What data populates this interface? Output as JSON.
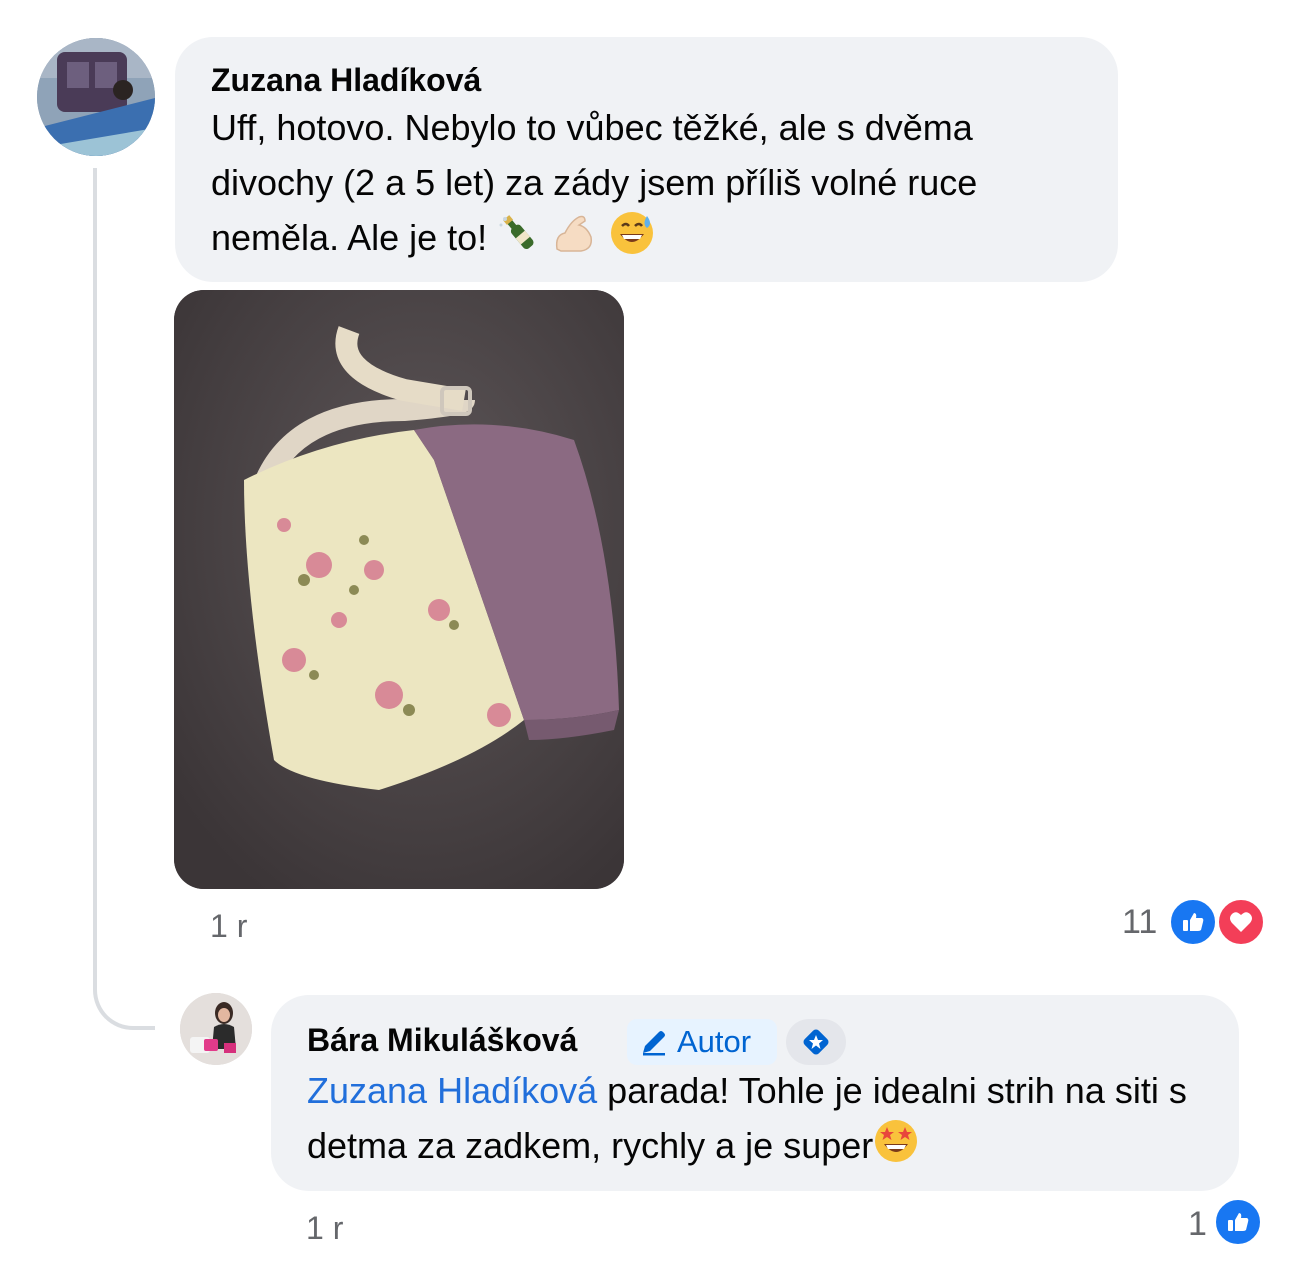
{
  "comments": [
    {
      "author": "Zuzana Hladíková",
      "text": "Uff, hotovo. Nebylo to vůbec těžké, ale s dvěma divochy (2 a 5 let) za zády jsem příliš volné ruce neměla. Ale je to!",
      "emojis": [
        "champagne-bottle",
        "flexed-biceps",
        "grinning-sweat-face"
      ],
      "time": "1 r",
      "reaction_count": "11",
      "reactions": [
        "like",
        "love"
      ]
    },
    {
      "author": "Bára Mikulášková",
      "badge_label": "Autor",
      "mention": "Zuzana Hladíková",
      "text": " parada! Tohle je idealni strih na siti s detma za zadkem, rychly a je super",
      "emojis": [
        "star-struck-face"
      ],
      "time": "1 r",
      "reaction_count": "1",
      "reactions": [
        "like"
      ]
    }
  ],
  "colors": {
    "bubble": "#f0f2f5",
    "mention": "#216fdb",
    "like": "#1877f2",
    "love": "#f33e58",
    "muted": "#65676b"
  }
}
